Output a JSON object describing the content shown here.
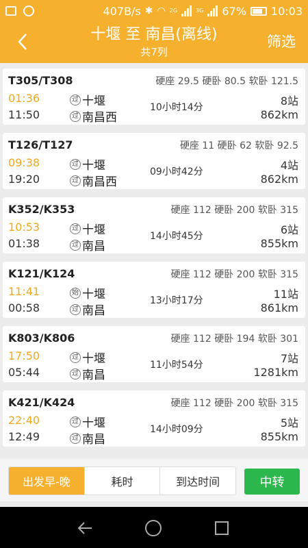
{
  "status_bar": {
    "speed": "407B/s",
    "battery": "67%",
    "time": "10:03",
    "net_2g": "2G",
    "net_3g": "3G"
  },
  "header": {
    "title": "十堰 至 南昌(离线)",
    "subtitle": "共7列",
    "filter_label": "筛选"
  },
  "trains": [
    {
      "number": "T305/T308",
      "seats": "硬座 29.5 硬卧 80.5 软卧 121.5",
      "dep_time": "01:36",
      "arr_time": "11:50",
      "dep_badge": "过",
      "dep_station": "十堰",
      "arr_badge": "过",
      "arr_station": "南昌西",
      "duration": "10小时14分",
      "stops": "8站",
      "distance": "862km"
    },
    {
      "number": "T126/T127",
      "seats": "硬座 11 硬卧 62 软卧 92.5",
      "dep_time": "09:38",
      "arr_time": "19:20",
      "dep_badge": "过",
      "dep_station": "十堰",
      "arr_badge": "过",
      "arr_station": "南昌西",
      "duration": "09小时42分",
      "stops": "4站",
      "distance": "862km"
    },
    {
      "number": "K352/K353",
      "seats": "硬座 112 硬卧 200 软卧 315",
      "dep_time": "10:53",
      "arr_time": "01:38",
      "dep_badge": "过",
      "dep_station": "十堰",
      "arr_badge": "过",
      "arr_station": "南昌",
      "duration": "14小时45分",
      "stops": "6站",
      "distance": "855km"
    },
    {
      "number": "K121/K124",
      "seats": "硬座 112 硬卧 200 软卧 315",
      "dep_time": "11:41",
      "arr_time": "00:58",
      "dep_badge": "始",
      "dep_station": "十堰",
      "arr_badge": "过",
      "arr_station": "南昌",
      "duration": "13小时17分",
      "stops": "11站",
      "distance": "861km"
    },
    {
      "number": "K803/K806",
      "seats": "硬座 112 硬卧 194 软卧 301",
      "dep_time": "17:50",
      "arr_time": "05:44",
      "dep_badge": "过",
      "dep_station": "十堰",
      "arr_badge": "过",
      "arr_station": "南昌",
      "duration": "11小时54分",
      "stops": "7站",
      "distance": "1281km"
    },
    {
      "number": "K421/K424",
      "seats": "硬座 112 硬卧 200 软卧 315",
      "dep_time": "22:40",
      "arr_time": "12:49",
      "dep_badge": "过",
      "dep_station": "十堰",
      "arr_badge": "过",
      "arr_station": "南昌",
      "duration": "14小时09分",
      "stops": "5站",
      "distance": "855km"
    }
  ],
  "sort_bar": {
    "options": [
      "出发早-晚",
      "耗时",
      "到达时间"
    ],
    "active_index": 0
  },
  "transfer_label": "中转",
  "colors": {
    "brand": "#f5b12e",
    "departure_time": "#f0a81e",
    "transfer": "#2db84d"
  }
}
